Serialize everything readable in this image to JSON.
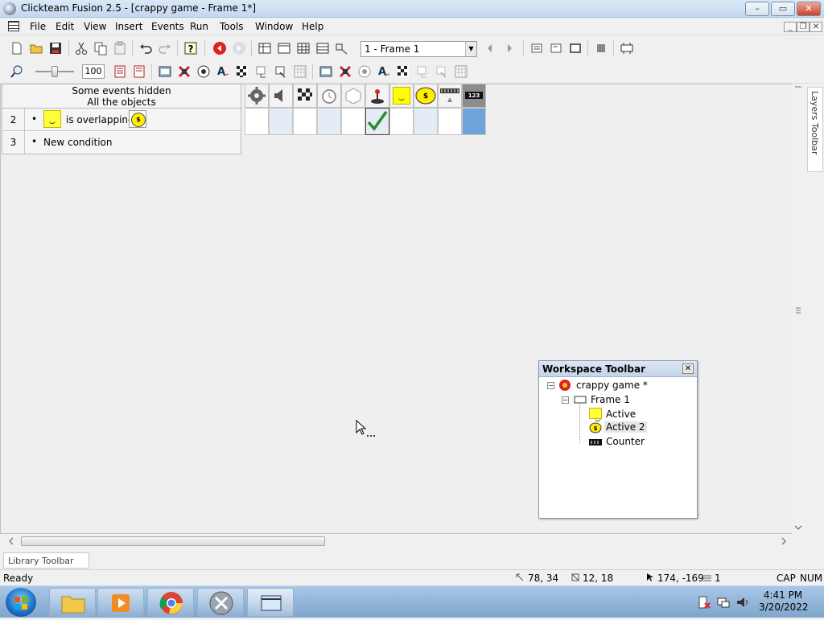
{
  "window": {
    "title": "Clickteam Fusion 2.5 - [crappy game - Frame 1*]",
    "buttons": {
      "minimize": "–",
      "maximize": "▭",
      "close": "✕"
    }
  },
  "menu": {
    "items": [
      "File",
      "Edit",
      "View",
      "Insert",
      "Events",
      "Run",
      "Tools",
      "Window",
      "Help"
    ],
    "mdi": {
      "minimize": "_",
      "restore": "❐",
      "close": "✕"
    }
  },
  "toolbar": {
    "frame_select": "1 - Frame 1",
    "zoom_value": "100"
  },
  "event_editor": {
    "header_line1": "Some events hidden",
    "header_line2": "All the objects",
    "events": [
      {
        "number": "2",
        "bullet": "•",
        "condition": "is overlapping"
      },
      {
        "number": "3",
        "bullet": "•",
        "condition": "New condition"
      }
    ],
    "grid_columns": [
      "system-icon",
      "sound-icon",
      "storyboard-icon",
      "timer-icon",
      "new-objects-icon",
      "player-joystick-icon",
      "active-smiley-icon",
      "active2-coin-icon",
      "keyboard-mouse-icon",
      "counter-icon"
    ],
    "check_column": 5
  },
  "layers_toolbar": {
    "label": "Layers Toolbar"
  },
  "workspace": {
    "title": "Workspace Toolbar",
    "close": "✕",
    "tree": [
      {
        "label": "crappy game *",
        "level": 0
      },
      {
        "label": "Frame 1",
        "level": 1
      },
      {
        "label": "Active",
        "level": 2
      },
      {
        "label": "Active 2",
        "level": 2
      },
      {
        "label": "Counter",
        "level": 2
      }
    ]
  },
  "library_toolbar": {
    "label": "Library Toolbar"
  },
  "status": {
    "text": "Ready",
    "pos": "78, 34",
    "size": "12, 18",
    "mouse": "174, -169",
    "layer": "1",
    "cap": "CAP",
    "num": "NUM"
  },
  "taskbar": {
    "time": "4:41 PM",
    "date": "3/20/2022"
  }
}
